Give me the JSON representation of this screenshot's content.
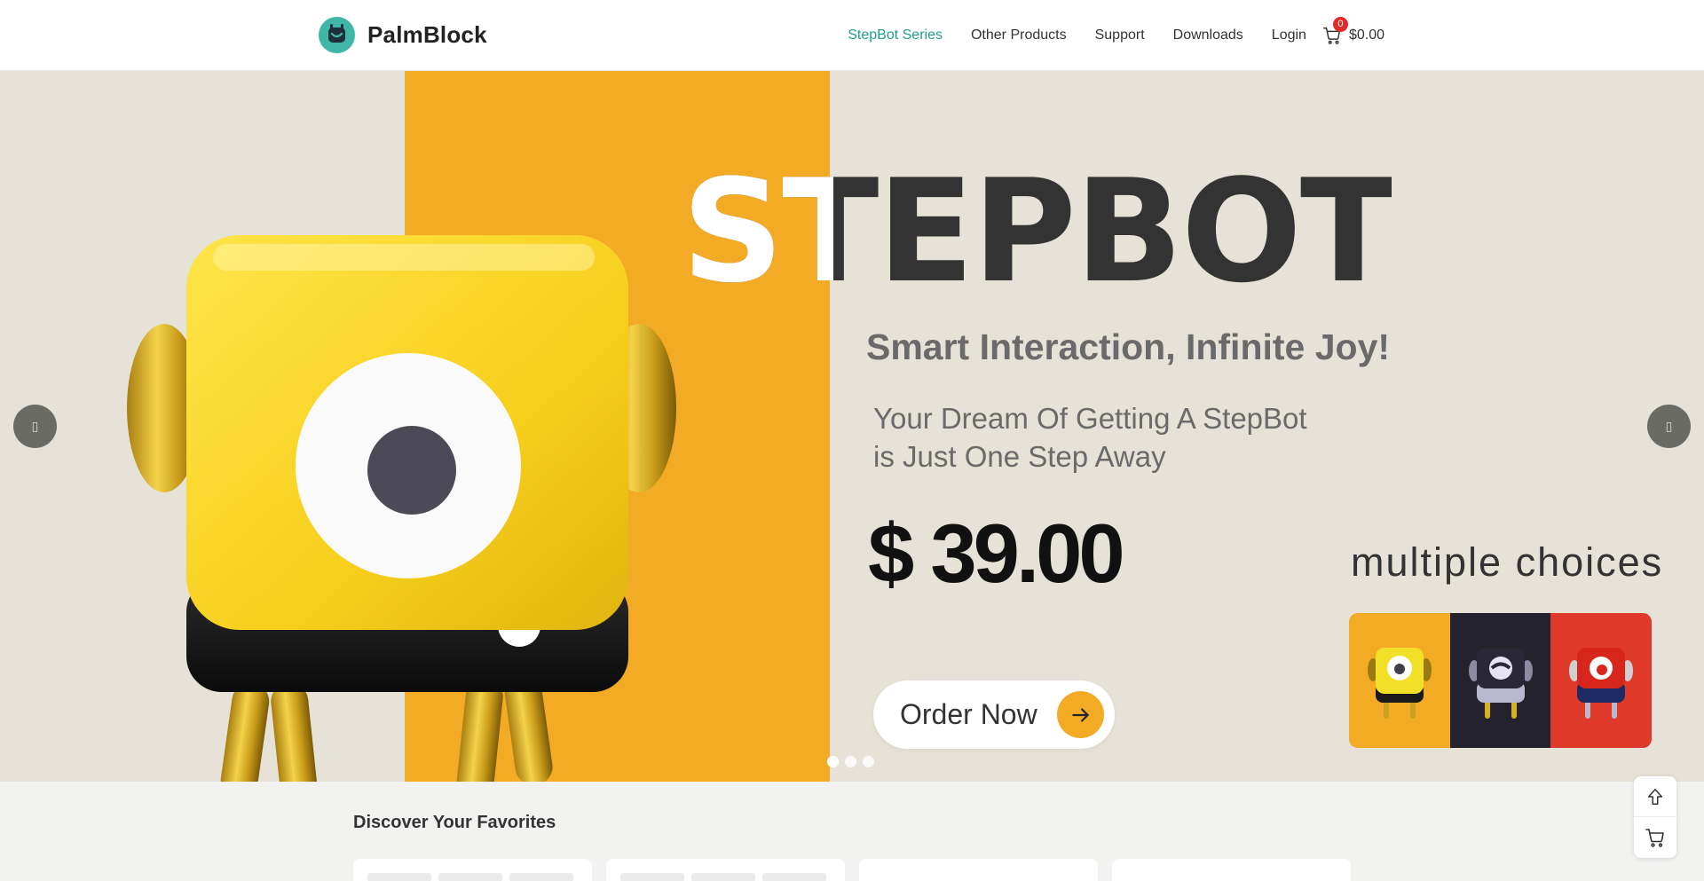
{
  "header": {
    "brand": "PalmBlock",
    "nav": [
      "StepBot Series",
      "Other Products",
      "Support",
      "Downloads",
      "Login"
    ],
    "active_nav": "StepBot Series",
    "cart_count": "0",
    "cart_total": "$0.00"
  },
  "hero": {
    "headline": "STEPBOT",
    "tagline": "Smart Interaction, Infinite Joy!",
    "subtitle_line1": "Your Dream Of Getting A StepBot",
    "subtitle_line2": "is Just One Step Away",
    "price": "$ 39.00",
    "cta": "Order Now",
    "choices_title": "multiple choices",
    "choices": [
      "yellow",
      "dark",
      "red"
    ],
    "slides_total": 3,
    "active_slide": 1,
    "prev_icon": "▯",
    "next_icon": "▯"
  },
  "discover": {
    "title": "Discover Your Favorites"
  },
  "colors": {
    "accent_teal": "#1f9e8c",
    "orange": "#f3ab26",
    "hero_bg": "#e6e2d7",
    "badge_red": "#e02a2a"
  },
  "icons": {
    "cart": "cart-icon",
    "arrow": "arrow-right-icon",
    "scroll_top": "arrow-up-icon",
    "floating_cart": "cart-icon"
  }
}
